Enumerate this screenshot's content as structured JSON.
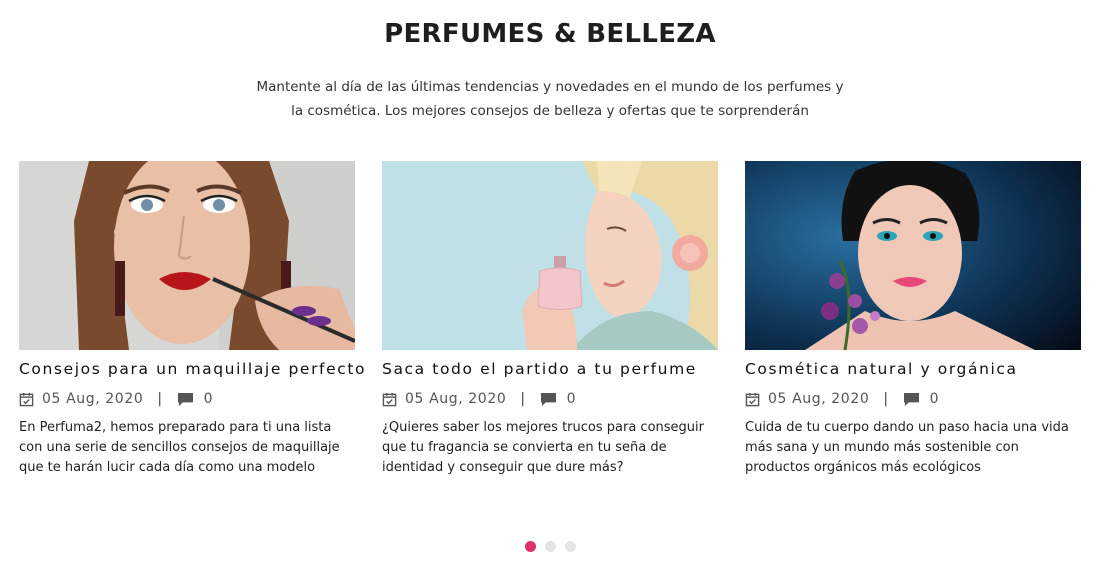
{
  "section": {
    "heading": "PERFUMES & BELLEZA",
    "intro_line1": "Mantente al día de las últimas tendencias y novedades en el mundo de los perfumes y",
    "intro_line2": "la cosmética. Los mejores consejos de belleza y ofertas que te sorprenderán"
  },
  "posts": [
    {
      "title": "Consejos para un maquillaje perfecto",
      "date": "05 Aug, 2020",
      "separator": "|",
      "comments": "0",
      "excerpt": "En Perfuma2, hemos preparado para ti una lista con una serie de sencillos consejos de maquillaje que te harán lucir cada día como una modelo",
      "image_icon": "makeup-photo"
    },
    {
      "title": "Saca todo el partido a tu perfume",
      "date": "05 Aug, 2020",
      "separator": "|",
      "comments": "0",
      "excerpt": "¿Quieres saber los mejores trucos para conseguir que tu fragancia se convierta en tu seña de identidad y conseguir que dure más?",
      "image_icon": "perfume-photo"
    },
    {
      "title": "Cosmética natural y orgánica",
      "date": "05 Aug, 2020",
      "separator": "|",
      "comments": "0",
      "excerpt": "Cuida de tu cuerpo dando un paso hacia una vida más sana y un mundo más sostenible con productos orgánicos más ecológicos",
      "image_icon": "organic-photo"
    }
  ],
  "pagination": {
    "active_index": 0,
    "count": 3,
    "active_color": "#e0306a",
    "inactive_color": "#e4e4e4"
  }
}
